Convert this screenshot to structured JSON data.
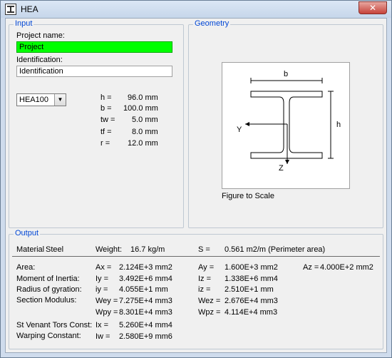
{
  "window": {
    "title": "HEA",
    "close_glyph": "✕"
  },
  "input": {
    "group_label": "Input",
    "project_label": "Project name:",
    "project_value": "Project",
    "ident_label": "Identification:",
    "ident_value": "Identification",
    "profile_selected": "HEA100",
    "dims": [
      {
        "name": "h =",
        "value": "96.0 mm"
      },
      {
        "name": "b =",
        "value": "100.0 mm"
      },
      {
        "name": "tw =",
        "value": "5.0 mm"
      },
      {
        "name": "tf =",
        "value": "8.0 mm"
      },
      {
        "name": "r =",
        "value": "12.0 mm"
      }
    ]
  },
  "geometry": {
    "group_label": "Geometry",
    "label_b": "b",
    "label_h": "h",
    "label_y": "Y",
    "label_z": "Z",
    "caption": "Figure to Scale"
  },
  "output": {
    "group_label": "Output",
    "material_label": "Material",
    "material_value": "Steel",
    "weight_label": "Weight:",
    "weight_value": "16.7 kg/m",
    "s_label": "S =",
    "s_value": "0.561 m2/m (Perimeter area)",
    "area_label": "Area:",
    "ax_label": "Ax =",
    "ax_value": "2.124E+3 mm2",
    "ay_label": "Ay =",
    "ay_value": "1.600E+3 mm2",
    "az_label": "Az =",
    "az_value": "4.000E+2 mm2",
    "moi_label": "Moment of Inertia:",
    "iy_label": "Iy =",
    "iy_value": "3.492E+6 mm4",
    "iz_label": "Iz =",
    "iz_value": "1.338E+6 mm4",
    "rog_label": "Radius of gyration:",
    "ry_label": "iy =",
    "ry_value": "4.055E+1 mm",
    "rz_label": "iz =",
    "rz_value": "2.510E+1 mm",
    "sm_label": "Section Modulus:",
    "wey_label": "Wey =",
    "wey_value": "7.275E+4 mm3",
    "wez_label": "Wez =",
    "wez_value": "2.676E+4 mm3",
    "wpy_label": "Wpy =",
    "wpy_value": "8.301E+4 mm3",
    "wpz_label": "Wpz =",
    "wpz_value": "4.114E+4 mm3",
    "tors_label": "St Venant Tors Const:",
    "ix_label": "Ix =",
    "ix_value": "5.260E+4 mm4",
    "warp_label": "Warping Constant:",
    "iw_label": "Iw =",
    "iw_value": "2.580E+9 mm6"
  }
}
